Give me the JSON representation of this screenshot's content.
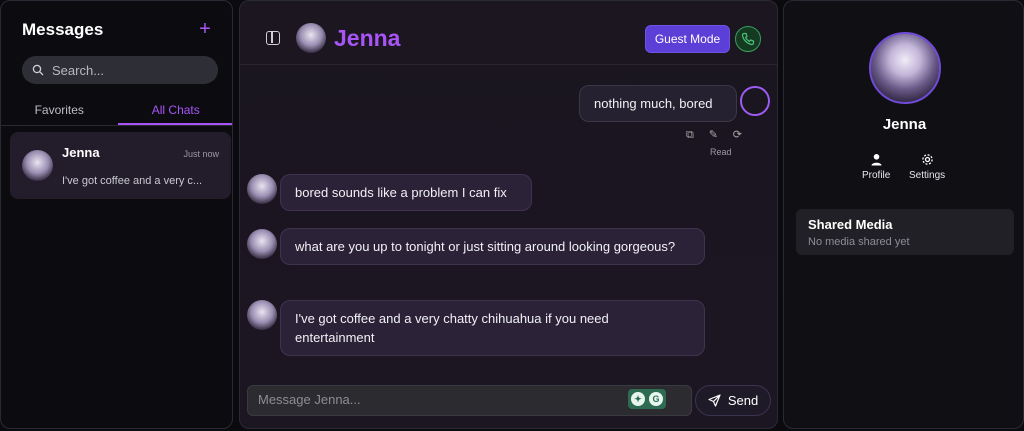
{
  "sidebar": {
    "title": "Messages",
    "add_icon": "plus-icon",
    "search_placeholder": "Search...",
    "tabs": [
      {
        "label": "Favorites",
        "active": false
      },
      {
        "label": "All Chats",
        "active": true
      }
    ],
    "chats": [
      {
        "name": "Jenna",
        "time": "Just now",
        "preview": "I've got coffee and a very c..."
      }
    ]
  },
  "chat": {
    "title": "Jenna",
    "guest_label": "Guest Mode",
    "accent": "#a855f7",
    "messages": [
      {
        "from": "user",
        "text": "nothing much, bored",
        "status": "Read"
      },
      {
        "from": "ai",
        "text": "bored sounds like a problem I can fix"
      },
      {
        "from": "ai",
        "text": "what are you up to tonight or just sitting around looking gorgeous?"
      },
      {
        "from": "ai",
        "text": "I've got coffee and a very chatty chihuahua if you need entertainment"
      }
    ],
    "composer_placeholder": "Message Jenna...",
    "send_label": "Send"
  },
  "profile": {
    "name": "Jenna",
    "actions": [
      {
        "label": "Profile",
        "icon": "user-icon"
      },
      {
        "label": "Settings",
        "icon": "gear-icon"
      }
    ],
    "shared_media": {
      "title": "Shared Media",
      "empty": "No media shared yet"
    }
  }
}
